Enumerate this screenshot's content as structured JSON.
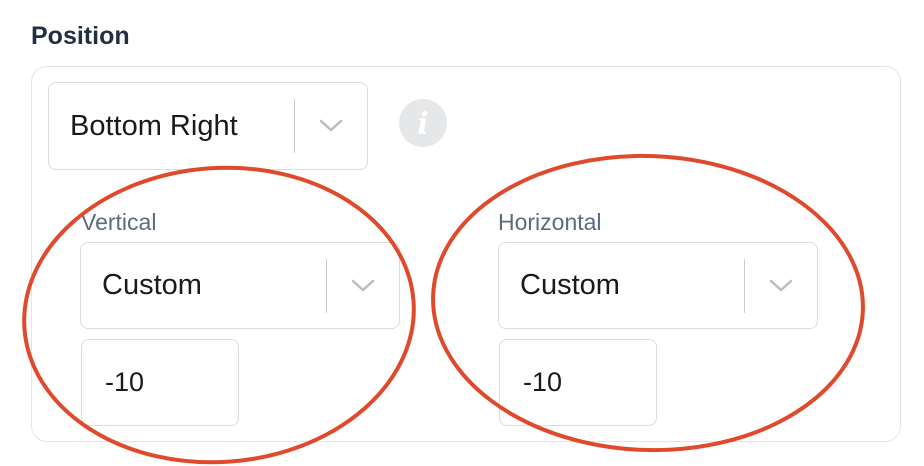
{
  "section": {
    "title": "Position"
  },
  "position_select": {
    "value": "Bottom Right"
  },
  "info_icon": {
    "name": "info-icon",
    "glyph": "i"
  },
  "vertical": {
    "label": "Vertical",
    "mode": "Custom",
    "offset": "-10"
  },
  "horizontal": {
    "label": "Horizontal",
    "mode": "Custom",
    "offset": "-10"
  },
  "colors": {
    "annotation": "#e04a2c",
    "border": "#d9dde2",
    "label": "#5d6b7e",
    "title": "#1f3044",
    "icon": "#e6e7e9"
  }
}
